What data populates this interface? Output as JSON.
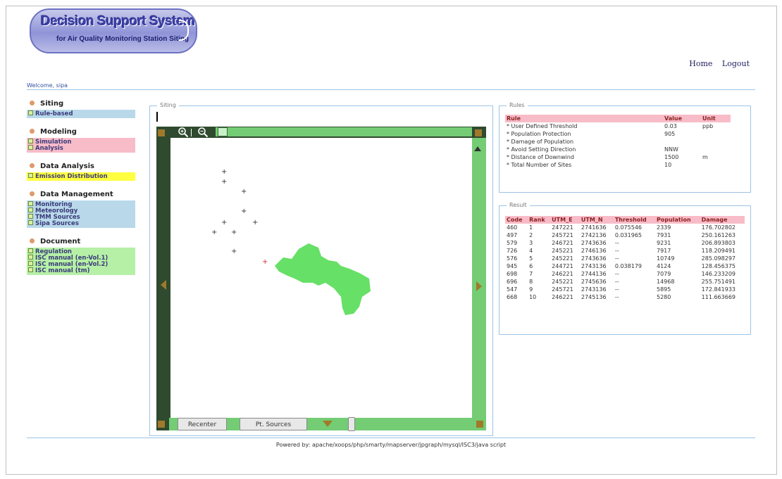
{
  "header": {
    "logo_title": "Decision Support System",
    "logo_subtitle": "for Air Quality Monitoring Station Siting",
    "links": [
      "Home",
      "Logout"
    ],
    "welcome": "Welcome, sipa"
  },
  "sidebar": {
    "groups": [
      {
        "title": "Siting",
        "color": "#b9d9ea",
        "items": [
          "Rule-based"
        ]
      },
      {
        "title": "Modeling",
        "color": "#f8bcc8",
        "items": [
          "Simulation",
          "Analysis"
        ]
      },
      {
        "title": "Data Analysis",
        "color": "#ffff40",
        "items": [
          "Emission Distribution"
        ]
      },
      {
        "title": "Data Management",
        "color": "#b9d9ea",
        "items": [
          "Monitoring",
          "Meteorology",
          "TMM Sources",
          "Sipa Sources"
        ]
      },
      {
        "title": "Document",
        "color": "#b6f0a6",
        "items": [
          "Regulation",
          "ISC manual (en-Vol.1)",
          "ISC manual (en-Vol.2)",
          "ISC manual (tm)"
        ]
      }
    ]
  },
  "siting": {
    "legend": "Siting",
    "zoom_in_icon": "zoom-in-icon",
    "zoom_out_icon": "zoom-out-icon",
    "buttons": {
      "recenter": "Recenter",
      "pt_sources": "Pt. Sources"
    }
  },
  "rules": {
    "legend": "Rules",
    "headers": [
      "Rule",
      "Value",
      "Unit"
    ],
    "rows": [
      [
        "* User Defined Threshold",
        "0.03",
        "ppb"
      ],
      [
        "* Population Protection",
        "905",
        ""
      ],
      [
        "* Damage of Population",
        "",
        ""
      ],
      [
        "* Avoid Setting Direction",
        "NNW",
        ""
      ],
      [
        "* Distance of Downwind",
        "1500",
        "m"
      ],
      [
        "* Total Number of Sites",
        "10",
        ""
      ]
    ]
  },
  "result": {
    "legend": "Result",
    "headers": [
      "Code",
      "Rank",
      "UTM_E",
      "UTM_N",
      "Threshold",
      "Population",
      "Damage"
    ],
    "rows": [
      [
        "460",
        "1",
        "247221",
        "2741636",
        "0.075546",
        "2339",
        "176.702802"
      ],
      [
        "497",
        "2",
        "245721",
        "2742136",
        "0.031965",
        "7931",
        "250.161263"
      ],
      [
        "579",
        "3",
        "246721",
        "2743636",
        "--",
        "9231",
        "206.893803"
      ],
      [
        "726",
        "4",
        "245221",
        "2746136",
        "--",
        "7917",
        "118.209491"
      ],
      [
        "576",
        "5",
        "245221",
        "2743636",
        "--",
        "10749",
        "285.098297"
      ],
      [
        "945",
        "6",
        "244721",
        "2743136",
        "0.038179",
        "4124",
        "128.456375"
      ],
      [
        "698",
        "7",
        "246221",
        "2744136",
        "--",
        "7079",
        "146.233209"
      ],
      [
        "696",
        "8",
        "245221",
        "2745636",
        "--",
        "14968",
        "255.751491"
      ],
      [
        "547",
        "9",
        "245721",
        "2743136",
        "--",
        "5895",
        "172.841933"
      ],
      [
        "668",
        "10",
        "246221",
        "2745136",
        "--",
        "5280",
        "111.663669"
      ]
    ]
  },
  "footer": "Powered by: apache/xoops/php/smarty/mapserver/jpgraph/mysql/ISC3/java script"
}
